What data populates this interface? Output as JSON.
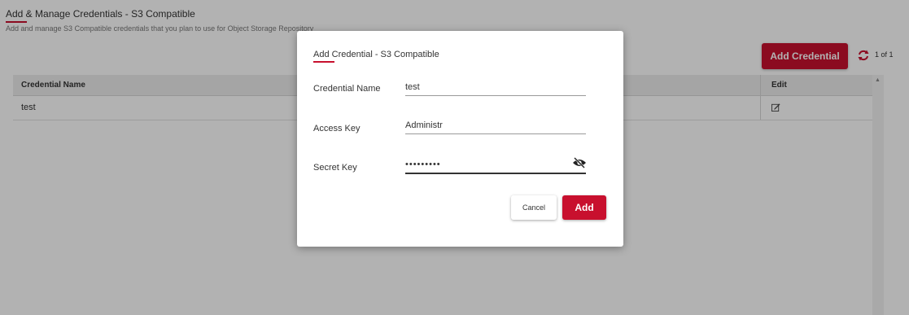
{
  "page": {
    "title": "Add & Manage Credentials - S3 Compatible",
    "subtitle": "Add and manage S3 Compatible credentials that you plan to use for Object Storage Repository"
  },
  "toolbar": {
    "add_credential_label": "Add Credential",
    "refresh_icon": "refresh-icon",
    "pager_text": "1 of 1"
  },
  "grid": {
    "columns": [
      "Credential Name",
      "Edit"
    ],
    "rows": [
      {
        "credential_name": "test",
        "edit_icon": "edit-icon"
      }
    ]
  },
  "modal": {
    "title": "Add Credential - S3 Compatible",
    "fields": [
      {
        "label": "Credential Name",
        "value": "test"
      },
      {
        "label": "Access Key",
        "value": "Administr"
      },
      {
        "label": "Secret Key",
        "value": "•••••••••"
      }
    ],
    "visibility_icon": "eye-off-icon",
    "cancel_label": "Cancel",
    "add_label": "Add"
  },
  "colors": {
    "accent": "#c8102e",
    "overlay": "rgba(0,0,0,0.3)"
  }
}
